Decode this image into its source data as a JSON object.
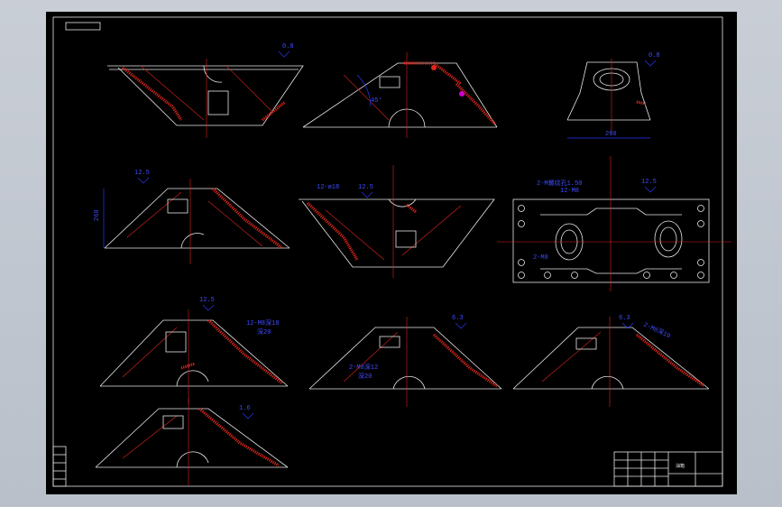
{
  "drawing": {
    "background": "#000000",
    "line_color": "#e8e8e8",
    "center_line_color": "#e0261d",
    "dimension_color": "#2a37ff",
    "view_1_roughness": "0.8",
    "view_2_angle": "45°",
    "view_3_roughness": "0.8",
    "view_3_dim": "260",
    "view_4_roughness": "12.5",
    "view_4_dim": "260",
    "view_5_note": "12-ø18",
    "view_5_roughness": "12.5",
    "view_6_note": "2-M螺纹孔1.50",
    "view_6_note2": "12-M8",
    "view_6_note3": "2-M8",
    "view_6_roughness": "12.5",
    "view_7_note": "12-M8深18",
    "view_7_sub": "深20",
    "view_7_roughness": "12.5",
    "view_8_note": "2-M8深12",
    "view_8_sub": "深20",
    "view_8_roughness": "6.3",
    "view_9_note": "2-M8深19",
    "view_9_roughness": "6.3",
    "view_10_roughness": "1.6",
    "title_block_title": "油箱"
  }
}
